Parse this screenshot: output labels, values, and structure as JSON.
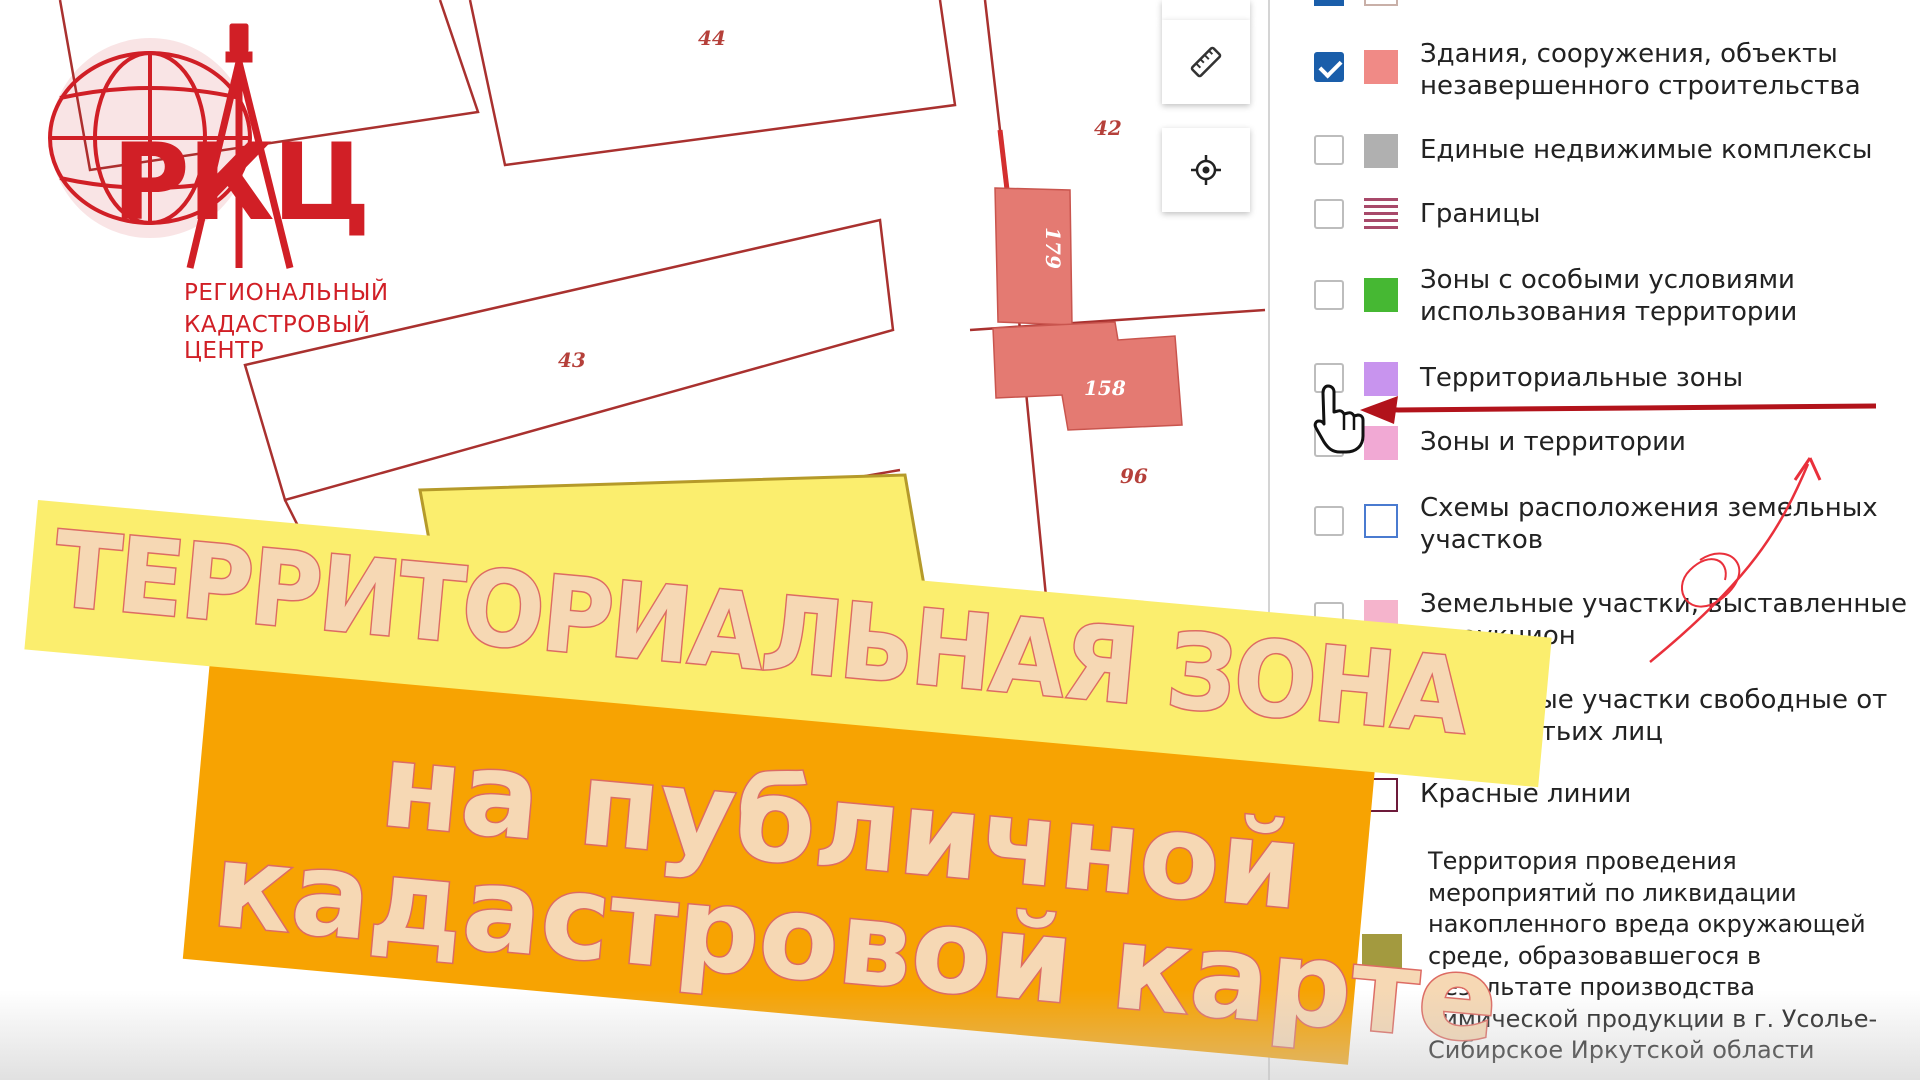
{
  "logo": {
    "abbr": "РКЦ",
    "line1": "РЕГИОНАЛЬНЫЙ",
    "line2": "КАДАСТРОВЫЙ ЦЕНТР"
  },
  "map": {
    "parcel_numbers": [
      "44",
      "42",
      "43",
      "96"
    ],
    "building_numbers": [
      "179",
      "158"
    ]
  },
  "tools": {
    "ruler_icon": "ruler-icon",
    "locate_icon": "crosshair-icon"
  },
  "layers": [
    {
      "label": "Здания, сооружения, объекты\nнезавершенного строительства",
      "checked": true,
      "swatch": "#f08a86"
    },
    {
      "label": "Единые недвижимые комплексы",
      "checked": false,
      "swatch": "#b0b0b0"
    },
    {
      "label": "Границы",
      "checked": false,
      "swatch": "stripes"
    },
    {
      "label": "Зоны с особыми условиями\nиспользования территории",
      "checked": false,
      "swatch": "#46b833"
    },
    {
      "label": "Территориальные зоны",
      "checked": false,
      "swatch": "#c894ee"
    },
    {
      "label": "Зоны и территории",
      "checked": false,
      "swatch": "#f1a9d4"
    },
    {
      "label": "Схемы расположения земельных\nучастков",
      "checked": false,
      "swatch": "outline-blue"
    },
    {
      "label": "Земельные участки, выставленные\nна аукцион",
      "checked": false,
      "swatch": "#f5b4cc"
    },
    {
      "label": "Земельные участки свободные от\nправ третьих лиц",
      "checked": false,
      "swatch": "#f5c7d8"
    },
    {
      "label": "Красные линии",
      "checked": false,
      "swatch": "outline-maroon"
    },
    {
      "label": "Территория проведения\nмероприятий по ликвидации\nнакопленного вреда окружающей\nсреде, образовавшегося в\nрезультате производства\nхимической продукции в г. Усолье-\nСибирское Иркутской области",
      "checked": false,
      "swatch": "#a39a3f"
    }
  ],
  "headline": {
    "line1": "ТЕРРИТОРИАЛЬНАЯ ЗОНА",
    "line2": "на публичной",
    "line3": "кадастровой карте"
  },
  "colors": {
    "brand_red": "#d11f26",
    "banner_yellow": "#fbee6e",
    "banner_orange": "#f7a302",
    "text_fill": "#f6d8b4",
    "text_outline": "#dd6b63",
    "arrow": "#b2131b",
    "parcel_line": "#a9312f",
    "building_fill": "#e47a72"
  }
}
